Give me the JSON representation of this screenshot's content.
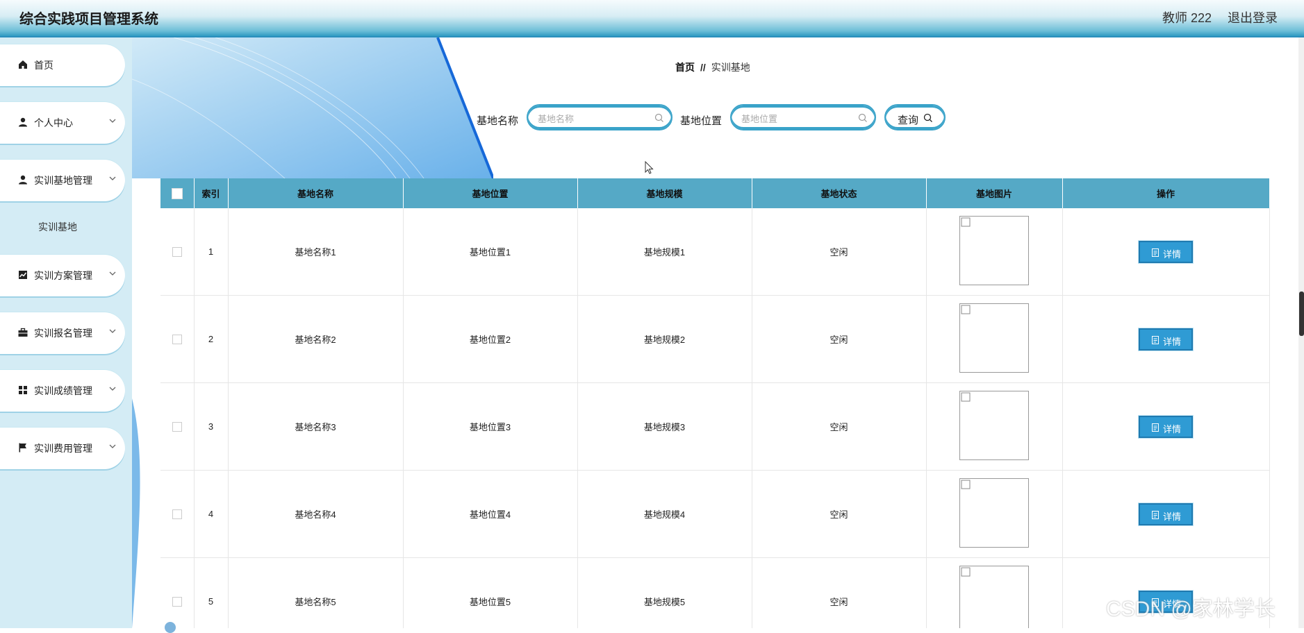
{
  "header": {
    "title": "综合实践项目管理系统",
    "user": "教师 222",
    "logout": "退出登录"
  },
  "sidebar": {
    "items": [
      {
        "label": "首页",
        "icon": "home-icon",
        "has_arrow": false
      },
      {
        "label": "个人中心",
        "icon": "user-icon",
        "has_arrow": true
      },
      {
        "label": "实训基地管理",
        "icon": "user-icon",
        "has_arrow": true
      },
      {
        "label": "实训方案管理",
        "icon": "chart-icon",
        "has_arrow": true
      },
      {
        "label": "实训报名管理",
        "icon": "briefcase-icon",
        "has_arrow": true
      },
      {
        "label": "实训成绩管理",
        "icon": "grid-icon",
        "has_arrow": true
      },
      {
        "label": "实训费用管理",
        "icon": "flag-icon",
        "has_arrow": true
      }
    ],
    "submenu": "实训基地"
  },
  "breadcrumb": {
    "home": "首页",
    "sep": "//",
    "current": "实训基地"
  },
  "filters": {
    "name_label": "基地名称",
    "name_placeholder": "基地名称",
    "location_label": "基地位置",
    "location_placeholder": "基地位置",
    "query": "查询"
  },
  "table": {
    "headers": [
      "索引",
      "基地名称",
      "基地位置",
      "基地规模",
      "基地状态",
      "基地图片",
      "操作"
    ],
    "rows": [
      {
        "index": "1",
        "name": "基地名称1",
        "location": "基地位置1",
        "scale": "基地规模1",
        "status": "空闲"
      },
      {
        "index": "2",
        "name": "基地名称2",
        "location": "基地位置2",
        "scale": "基地规模2",
        "status": "空闲"
      },
      {
        "index": "3",
        "name": "基地名称3",
        "location": "基地位置3",
        "scale": "基地规模3",
        "status": "空闲"
      },
      {
        "index": "4",
        "name": "基地名称4",
        "location": "基地位置4",
        "scale": "基地规模4",
        "status": "空闲"
      },
      {
        "index": "5",
        "name": "基地名称5",
        "location": "基地位置5",
        "scale": "基地规模5",
        "status": "空闲"
      }
    ],
    "detail_label": "详情"
  },
  "watermark": "CSDN @家林学长",
  "colors": {
    "accent": "#2f9bd4",
    "header_bg": "#55a9c6",
    "sidebar_bg": "#d4ecf5"
  }
}
